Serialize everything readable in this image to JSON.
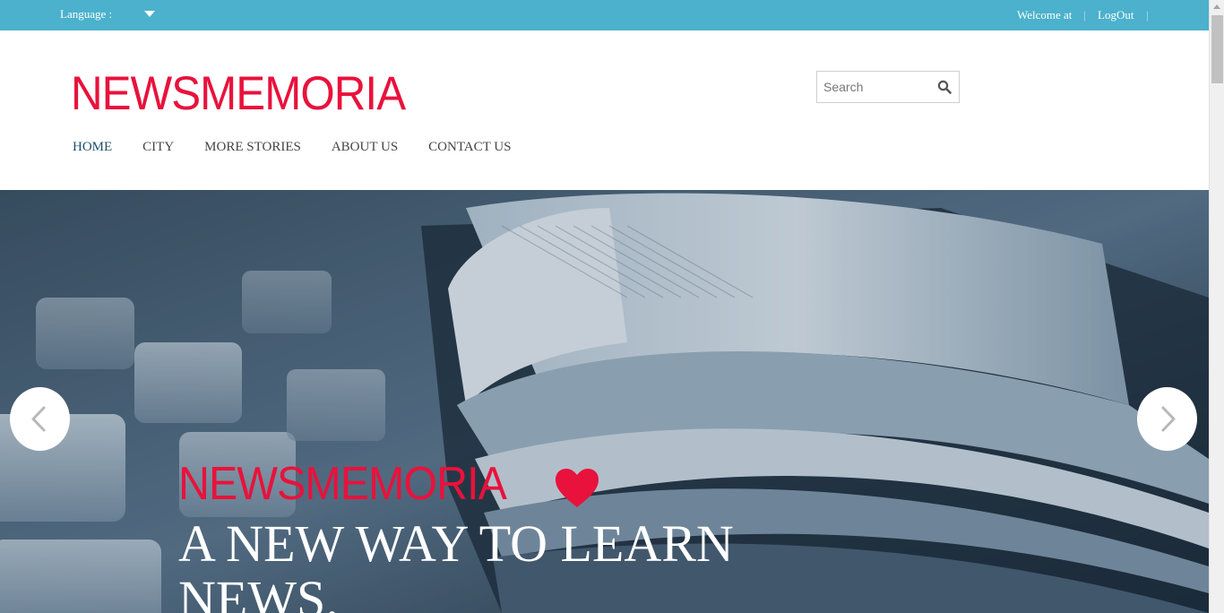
{
  "topbar": {
    "language_label": "Language :",
    "welcome_text": "Welcome at",
    "logout_label": "LogOut",
    "separator": "|"
  },
  "header": {
    "logo": "NEWSMEMORIA",
    "search_placeholder": "Search"
  },
  "nav": {
    "items": [
      {
        "label": "HOME",
        "active": true
      },
      {
        "label": "CITY"
      },
      {
        "label": "MORE STORIES"
      },
      {
        "label": "ABOUT US"
      },
      {
        "label": "CONTACT US"
      }
    ]
  },
  "hero": {
    "title": "NEWSMEMORIA",
    "tagline": "A NEW WAY TO LEARN NEWS.",
    "prev_icon": "chevron-left-icon",
    "next_icon": "chevron-right-icon",
    "heart_icon": "heart-icon"
  },
  "colors": {
    "topbar": "#4bb1cc",
    "brand": "#e8123c",
    "nav_active": "#1d4e6b",
    "nav_text": "#444444"
  }
}
